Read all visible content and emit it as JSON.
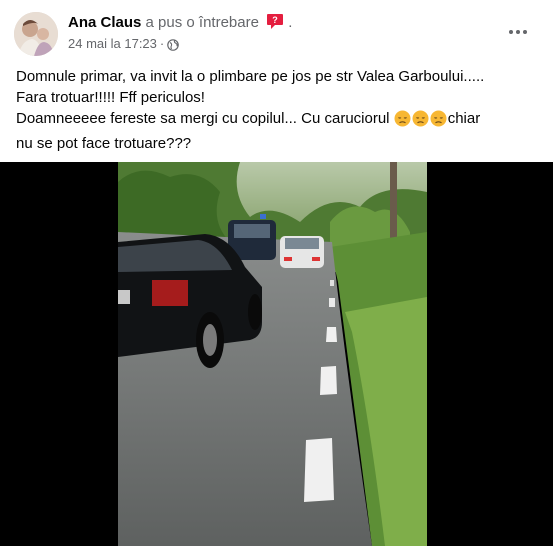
{
  "author": {
    "name": "Ana Claus",
    "action": "a pus o întrebare",
    "trailing": "."
  },
  "meta": {
    "date": "24 mai la 17:23",
    "separator": "·"
  },
  "post": {
    "line1": "Domnule primar, va invit la o plimbare pe jos pe str Valea Garboului.....",
    "line2": "Fara trotuar!!!!! Fff periculos!",
    "line3": "Doamneeeee fereste sa mergi cu copilul... Cu caruciorul",
    "line3_tail": "chiar",
    "line4": "nu se pot face trotuare???",
    "emoji_count": 3
  },
  "icons": {
    "question": "question-badge-icon",
    "audience": "globe-icon",
    "more": "more-options-icon",
    "emoji": "disappointed-face-emoji"
  },
  "colors": {
    "question_badge": "#e41e3f",
    "secondary_text": "#65676b",
    "emoji_yellow": "#f7b733"
  }
}
